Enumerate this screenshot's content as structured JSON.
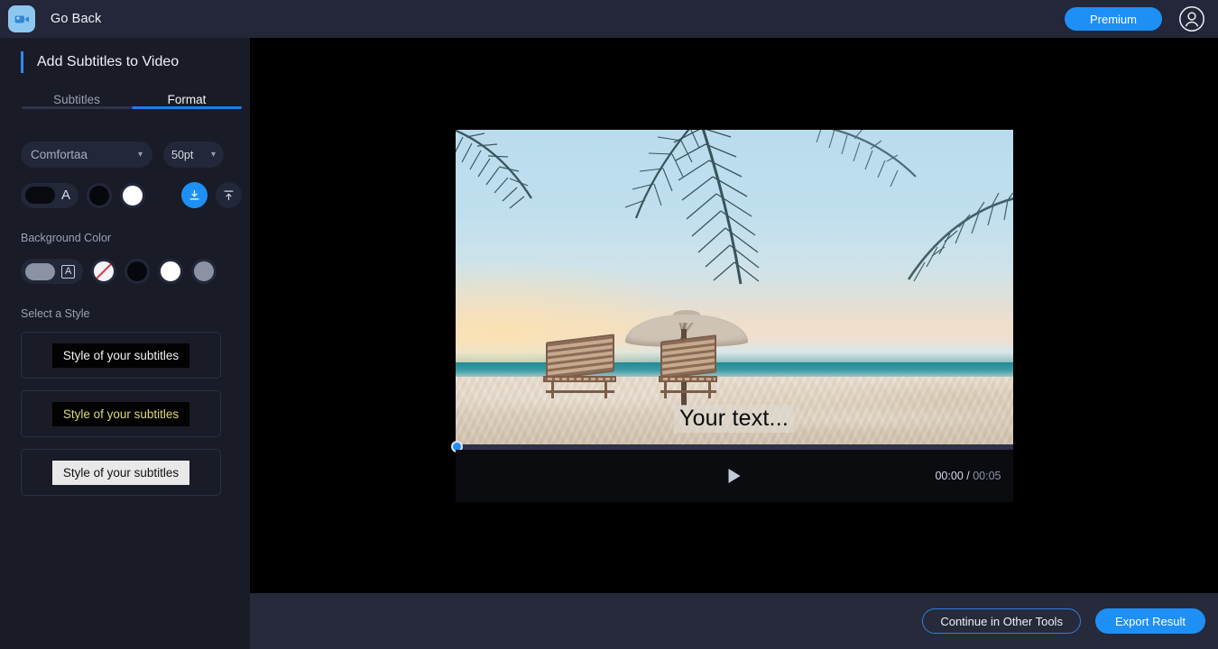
{
  "header": {
    "logo_icon": "video-camera-icon",
    "go_back_label": "Go Back",
    "premium_label": "Premium",
    "avatar_icon": "user-avatar-icon"
  },
  "sidebar": {
    "panel_title": "Add Subtitles to Video",
    "tabs": [
      {
        "label": "Subtitles",
        "active": false
      },
      {
        "label": "Format",
        "active": true
      }
    ],
    "font": {
      "family_value": "Comfortaa",
      "family_chevron": "chevron-down-icon",
      "size_value": "50pt",
      "size_chevron": "chevron-down-icon"
    },
    "text_color": {
      "selected_chip_color": "#080a10",
      "letter": "A",
      "swatches": [
        {
          "name": "black",
          "color": "#07080c"
        },
        {
          "name": "white",
          "color": "#ffffff"
        }
      ]
    },
    "alignment": {
      "bottom_label": "align-bottom",
      "top_label": "align-top",
      "active": "bottom"
    },
    "background_color": {
      "label": "Background Color",
      "selected_chip_color": "#8b92a2",
      "letter": "A",
      "swatches": [
        {
          "name": "transparent",
          "color": "#f4f4f6"
        },
        {
          "name": "black",
          "color": "#07080c"
        },
        {
          "name": "white",
          "color": "#ffffff"
        },
        {
          "name": "gray",
          "color": "#8b92a2"
        }
      ]
    },
    "styles": {
      "label": "Select a Style",
      "items": [
        {
          "text": "Style of your subtitles",
          "fg": "#f2f2f2",
          "bg": "#030303"
        },
        {
          "text": "Style of your subtitles",
          "fg": "#dada7c",
          "bg": "#030303"
        },
        {
          "text": "Style of your subtitles",
          "fg": "#121212",
          "bg": "#e8e8e8"
        }
      ]
    }
  },
  "player": {
    "subtitle_text": "Your text...",
    "current_time": "00:00",
    "separator": "/",
    "total_time": "00:05",
    "play_icon": "play-icon",
    "progress_percent": 0
  },
  "bottombar": {
    "continue_label": "Continue in Other Tools",
    "export_label": "Export Result"
  },
  "colors": {
    "accent_blue": "#1e90f5",
    "header_bg": "#24263a",
    "sidebar_bg": "#191b26",
    "bottombar_bg": "#272a3a",
    "canvas_bg": "#000000"
  }
}
